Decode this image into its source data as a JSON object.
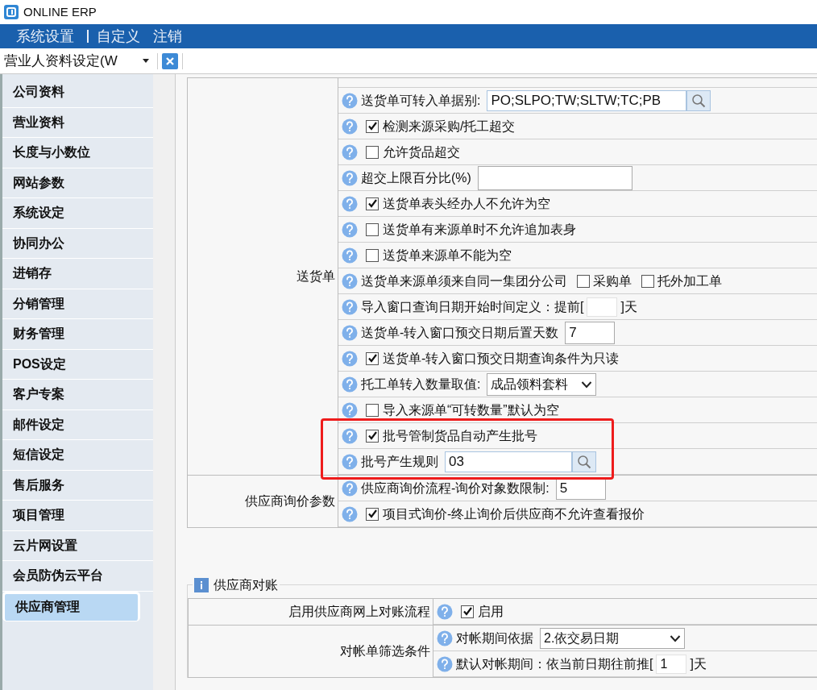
{
  "window": {
    "title": "ONLINE ERP"
  },
  "menu": [
    {
      "label": "系统设置",
      "separator_after": true
    },
    {
      "label": "自定义",
      "separator_after": false
    },
    {
      "label": "注销",
      "separator_after": false
    }
  ],
  "doc_tab": {
    "label": "营业人资料设定(W"
  },
  "sidebar": {
    "items": [
      {
        "label": "公司资料",
        "selected": false,
        "highlighted": false
      },
      {
        "label": "营业资料",
        "selected": false,
        "highlighted": false
      },
      {
        "label": "长度与小数位",
        "selected": false,
        "highlighted": false
      },
      {
        "label": "网站参数",
        "selected": false,
        "highlighted": false
      },
      {
        "label": "系统设定",
        "selected": false,
        "highlighted": false
      },
      {
        "label": "协同办公",
        "selected": false,
        "highlighted": false
      },
      {
        "label": "进销存",
        "selected": false,
        "highlighted": false
      },
      {
        "label": "分销管理",
        "selected": false,
        "highlighted": false
      },
      {
        "label": "财务管理",
        "selected": false,
        "highlighted": false
      },
      {
        "label": "POS设定",
        "selected": false,
        "highlighted": false
      },
      {
        "label": "客户专案",
        "selected": false,
        "highlighted": false
      },
      {
        "label": "邮件设定",
        "selected": false,
        "highlighted": false
      },
      {
        "label": "短信设定",
        "selected": false,
        "highlighted": false
      },
      {
        "label": "售后服务",
        "selected": false,
        "highlighted": false
      },
      {
        "label": "项目管理",
        "selected": false,
        "highlighted": false
      },
      {
        "label": "云片网设置",
        "selected": false,
        "highlighted": false
      },
      {
        "label": "会员防伪云平台",
        "selected": false,
        "highlighted": false
      },
      {
        "label": "供应商管理",
        "selected": true,
        "highlighted": true
      }
    ]
  },
  "settings_groups": [
    {
      "label": "送货单",
      "rows": [
        {
          "kind": "clipped",
          "highlighted": false
        },
        {
          "kind": "lookup",
          "label": "送货单可转入单据别:",
          "value": "PO;SLPO;TW;SLTW;TC;PB",
          "highlighted": false
        },
        {
          "kind": "checkbox",
          "label": "检测来源采购/托工超交",
          "checked": true,
          "highlighted": false
        },
        {
          "kind": "checkbox",
          "label": "允许货品超交",
          "checked": false,
          "highlighted": false
        },
        {
          "kind": "input",
          "label": "超交上限百分比(%)",
          "value": "",
          "highlighted": false
        },
        {
          "kind": "checkbox",
          "label": "送货单表头经办人不允许为空",
          "checked": true,
          "highlighted": false
        },
        {
          "kind": "checkbox",
          "label": "送货单有来源单时不允许追加表身",
          "checked": false,
          "highlighted": false
        },
        {
          "kind": "checkbox",
          "label": "送货单来源单不能为空",
          "checked": false,
          "highlighted": false
        },
        {
          "kind": "checkbox_group",
          "label": "送货单来源单须来自同一集团分公司",
          "options": [
            {
              "label": "采购单",
              "checked": false
            },
            {
              "label": "托外加工单",
              "checked": false
            }
          ],
          "highlighted": false
        },
        {
          "kind": "bracket",
          "label": "导入窗口查询日期开始时间定义：提前[",
          "value": "",
          "suffix": "]天",
          "highlighted": false
        },
        {
          "kind": "small_input",
          "label": "送货单-转入窗口预交日期后置天数",
          "value": "7",
          "highlighted": false
        },
        {
          "kind": "checkbox",
          "label": "送货单-转入窗口预交日期查询条件为只读",
          "checked": true,
          "highlighted": false
        },
        {
          "kind": "select",
          "label": "托工单转入数量取值:",
          "value": "成品领料套料",
          "highlighted": false
        },
        {
          "kind": "checkbox",
          "label": "导入来源单“可转数量”默认为空",
          "checked": false,
          "highlighted": false
        },
        {
          "kind": "checkbox",
          "label": "批号管制货品自动产生批号",
          "checked": true,
          "highlighted": true
        },
        {
          "kind": "lookup",
          "label": "批号产生规则",
          "value": "03",
          "highlighted": true
        }
      ]
    },
    {
      "label": "供应商询价参数",
      "rows": [
        {
          "kind": "small_input",
          "label": "供应商询价流程-询价对象数限制:",
          "value": "5",
          "highlighted": false
        },
        {
          "kind": "checkbox",
          "label": "项目式询价-终止询价后供应商不允许查看报价",
          "checked": true,
          "highlighted": false
        }
      ]
    }
  ],
  "reconciliation": {
    "title": "供应商对账",
    "groups": [
      {
        "label": "启用供应商网上对账流程",
        "rows": [
          {
            "kind": "checkbox",
            "label": "启用",
            "checked": true,
            "highlighted": false
          }
        ]
      },
      {
        "label": "对帐单筛选条件",
        "rows": [
          {
            "kind": "wide_select",
            "label": "对帐期间依据",
            "value": "2.依交易日期",
            "highlighted": false
          },
          {
            "kind": "bracket",
            "label": "默认对帐期间：依当前日期往前推[",
            "value": "1",
            "suffix": "]天",
            "highlighted": false
          }
        ]
      }
    ]
  }
}
